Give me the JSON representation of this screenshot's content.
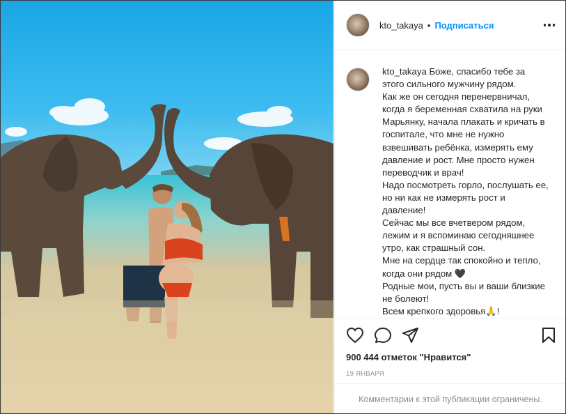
{
  "post": {
    "username": "kto_takaya",
    "dot": "•",
    "follow_label": "Подписаться",
    "caption_lines": [
      "Боже, спасибо тебе за этого сильного мужчину рядом.",
      "Как же он сегодня перенервничал, когда я беременная схватила на руки Марьянку, начала плакать и кричать в госпитале, что мне не нужно взвешивать ребёнка, измерять ему давление и рост. Мне просто нужен переводчик и врач!",
      "Надо посмотреть горло, послушать ее, но ни как не измерять рост и давление!",
      "Сейчас мы все вчетвером рядом, лежим и я вспоминаю сегодняшнее утро, как страшный сон.",
      "Мне на сердце так спокойно и тепло, когда они рядом 🖤",
      "Родные мои, пусть вы и ваши близкие не болеют!",
      "Всем крепкого здоровья🙏!"
    ],
    "likes_text": "900 444 отметок \"Нравится\"",
    "date_text": "19 ЯНВАРЯ",
    "comments_disabled_text": "Комментарии к этой публикации ограничены.",
    "icons": {
      "like": "heart-icon",
      "comment": "comment-icon",
      "share": "share-icon",
      "save": "bookmark-icon",
      "more": "more-dots-icon"
    }
  },
  "colors": {
    "accent": "#0095f6",
    "text": "#262626",
    "muted": "#8e8e8e",
    "border": "#efefef"
  }
}
